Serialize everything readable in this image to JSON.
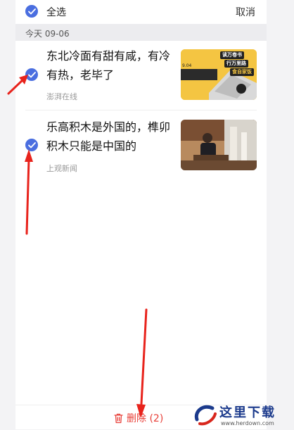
{
  "header": {
    "select_all_label": "全选",
    "cancel_label": "取消"
  },
  "date_group": {
    "label": "今天 09-06"
  },
  "items": [
    {
      "title": "东北冷面有甜有咸，有冷有热，老毕了",
      "source": "澎湃在线",
      "selected": true,
      "thumbnail_text": [
        "读万卷书",
        "行万里路",
        "食自家饭",
        "9.04"
      ]
    },
    {
      "title": "乐高积木是外国的，榫卯积木只能是中国的",
      "source": "上观新闻",
      "selected": true
    }
  ],
  "footer": {
    "delete_label": "删除 (2)"
  },
  "watermark": {
    "text": "这里下载",
    "url": "www.herdown.com"
  },
  "colors": {
    "accent": "#4a6ee0",
    "delete": "#e8413a",
    "arrow": "#e8231c"
  }
}
